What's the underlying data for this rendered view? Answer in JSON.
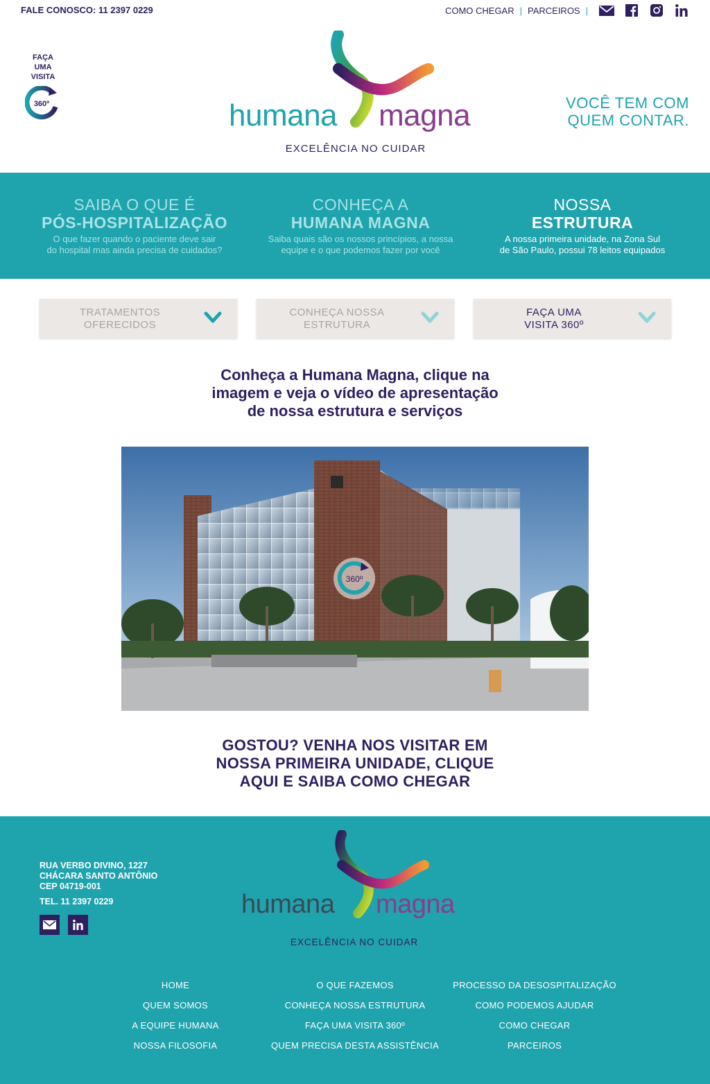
{
  "topbar": {
    "contact": "FALE CONOSCO: 11 2397 0229",
    "links": [
      "COMO CHEGAR",
      "PARCEIROS"
    ],
    "separator": "|",
    "social_icons": [
      "email-icon",
      "facebook-icon",
      "instagram-icon",
      "linkedin-icon"
    ]
  },
  "header": {
    "visit_label": [
      "FAÇA",
      "UMA",
      "VISITA"
    ],
    "visit_badge": "360º",
    "logo": {
      "word1": "humana",
      "word2": "magna",
      "tagline": "EXCELÊNCIA NO CUIDAR"
    },
    "slogan": [
      "VOCÊ TEM COM",
      "QUEM CONTAR."
    ]
  },
  "band": {
    "features": [
      {
        "line1": "SAIBA O QUE É",
        "line2": "PÓS-HOSPITALIZAÇÃO",
        "desc1": "O que fazer quando o paciente deve sair",
        "desc2": "do hospital mas ainda precisa de cuidados?"
      },
      {
        "line1": "CONHEÇA A",
        "line2": "HUMANA MAGNA",
        "desc1": "Saiba quais são os nossos princípios, a nossa",
        "desc2": "equipe e o que podemos fazer por você"
      },
      {
        "line1": "NOSSA",
        "line2": "ESTRUTURA",
        "desc1": "A nossa primeira unidade, na Zona Sul",
        "desc2": "de São Paulo, possui 78 leitos equipados"
      }
    ]
  },
  "tabs": [
    {
      "line1": "TRATAMENTOS",
      "line2": "OFERECIDOS"
    },
    {
      "line1": "CONHEÇA NOSSA",
      "line2": "ESTRUTURA"
    },
    {
      "line1": "FAÇA UMA",
      "line2": "VISITA 360º"
    }
  ],
  "intro": [
    "Conheça a Humana Magna, clique na",
    "imagem e veja o vídeo de apresentação",
    "de nossa estrutura e serviços"
  ],
  "photo": {
    "badge": "360º"
  },
  "cta": [
    "GOSTOU? VENHA NOS VISITAR EM",
    "NOSSA PRIMEIRA UNIDADE, CLIQUE",
    "AQUI E SAIBA COMO CHEGAR"
  ],
  "footer": {
    "address": [
      "RUA VERBO DIVINO, 1227",
      "CHÁCARA SANTO ANTÔNIO",
      "CEP 04719-001"
    ],
    "tel": "TEL. 11 2397 0229",
    "logo": {
      "word1": "humana",
      "word2": "magna",
      "tagline": "EXCELÊNCIA NO CUIDAR"
    },
    "nav_col1": [
      "HOME",
      "QUEM SOMOS",
      "A EQUIPE HUMANA",
      "NOSSA FILOSOFIA"
    ],
    "nav_col2": [
      "O QUE FAZEMOS",
      "CONHEÇA NOSSA ESTRUTURA",
      "FAÇA UMA VISITA 360º",
      "QUEM PRECISA DESTA ASSISTÊNCIA"
    ],
    "nav_col3": [
      "PROCESSO DA DESOSPITALIZAÇÃO",
      "COMO PODEMOS AJUDAR",
      "COMO CHEGAR",
      "PARCEIROS"
    ]
  },
  "colors": {
    "teal": "#1fa3ad",
    "navy": "#2e1f5e",
    "tab_bg": "#ebe8e6",
    "light_teal_text": "#a8e3e7"
  }
}
